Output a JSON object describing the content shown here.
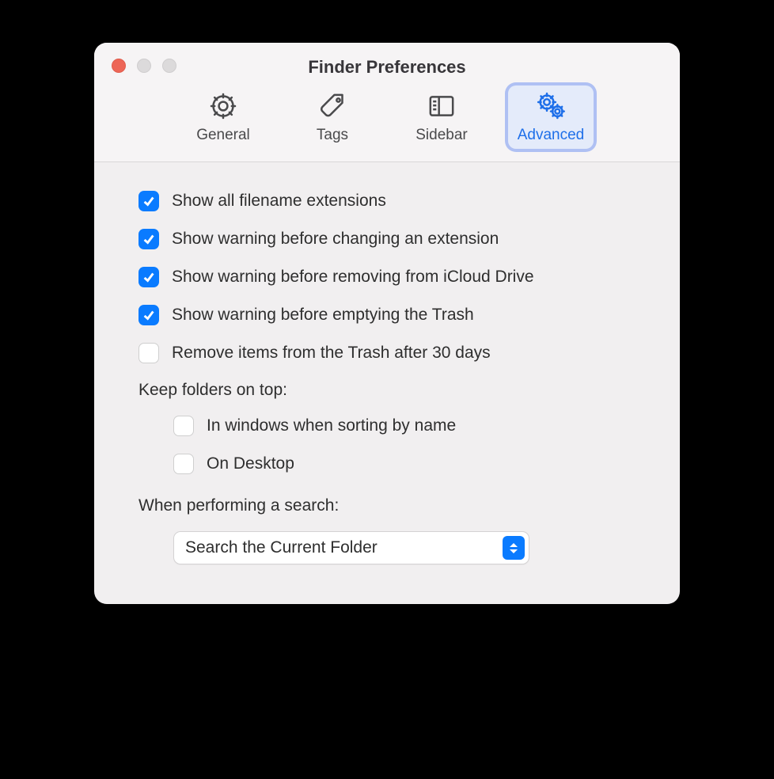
{
  "window": {
    "title": "Finder Preferences",
    "traffic": {
      "close": "#ed6657",
      "inactive": "#dcdadb"
    }
  },
  "toolbar": {
    "tabs": [
      {
        "label": "General",
        "icon": "gear-icon",
        "selected": false
      },
      {
        "label": "Tags",
        "icon": "tag-icon",
        "selected": false
      },
      {
        "label": "Sidebar",
        "icon": "sidebar-icon",
        "selected": false
      },
      {
        "label": "Advanced",
        "icon": "gears-icon",
        "selected": true
      }
    ]
  },
  "options": {
    "group1": [
      {
        "label": "Show all filename extensions",
        "checked": true
      },
      {
        "label": "Show warning before changing an extension",
        "checked": true
      },
      {
        "label": "Show warning before removing from iCloud Drive",
        "checked": true
      },
      {
        "label": "Show warning before emptying the Trash",
        "checked": true
      },
      {
        "label": "Remove items from the Trash after 30 days",
        "checked": false
      }
    ],
    "keep_folders_label": "Keep folders on top:",
    "group2": [
      {
        "label": "In windows when sorting by name",
        "checked": false
      },
      {
        "label": "On Desktop",
        "checked": false
      }
    ],
    "search_label": "When performing a search:",
    "search_value": "Search the Current Folder"
  }
}
